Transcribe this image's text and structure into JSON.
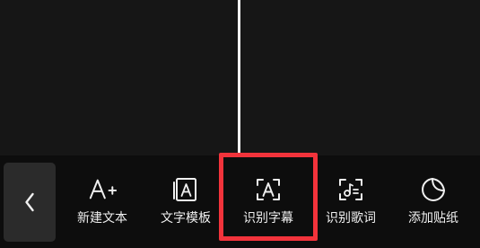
{
  "toolbar": {
    "back_icon": "chevron-left-icon",
    "items": [
      {
        "label": "新建文本",
        "icon": "add-text-icon",
        "highlighted": false
      },
      {
        "label": "文字模板",
        "icon": "text-template-icon",
        "highlighted": false
      },
      {
        "label": "识别字幕",
        "icon": "recognize-subtitle-icon",
        "highlighted": true
      },
      {
        "label": "识别歌词",
        "icon": "recognize-lyrics-icon",
        "highlighted": false
      },
      {
        "label": "添加贴纸",
        "icon": "add-sticker-icon",
        "highlighted": false
      }
    ]
  },
  "colors": {
    "background": "#151515",
    "toolbar": "#0d0d0d",
    "back_button": "#2b2b2b",
    "text": "#f0f0f0",
    "highlight": "#f2333b",
    "playhead": "#f2f2f2"
  }
}
